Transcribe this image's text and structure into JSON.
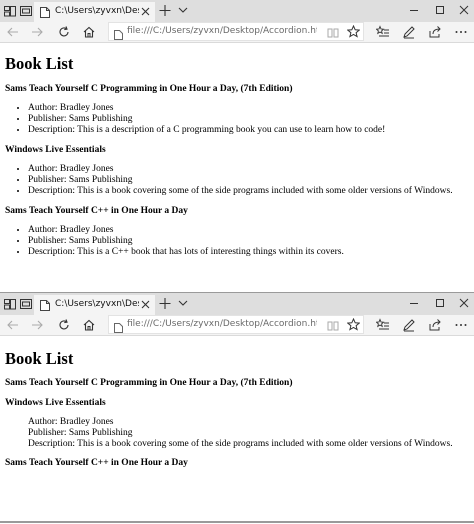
{
  "browser": {
    "tab_title": "C:\\Users\\zyvxn\\Desktop",
    "url": "file:///C:/Users/zyvxn/Desktop/Accordion.html"
  },
  "page": {
    "heading": "Book List",
    "books": [
      {
        "title": "Sams Teach Yourself C Programming in One Hour a Day, (7th Edition)",
        "author": "Author: Bradley Jones",
        "publisher": "Publisher: Sams Publishing",
        "description": "Description: This is a description of a C programming book you can use to learn how to code!"
      },
      {
        "title": "Windows Live Essentials",
        "author": "Author: Bradley Jones",
        "publisher": "Publisher: Sams Publishing",
        "description": "Description: This is a book covering some of the side programs included with some older versions of Windows."
      },
      {
        "title": "Sams Teach Yourself C++ in One Hour a Day",
        "author": "Author: Bradley Jones",
        "publisher": "Publisher: Sams Publishing",
        "description": "Description: This is a C++ book that has lots of interesting things within its covers."
      }
    ]
  },
  "colors": {
    "titlebar": "#dedede",
    "tab_active": "#f4f4f4",
    "navbar": "#f4f4f4",
    "url_text": "#6a6a6a"
  }
}
